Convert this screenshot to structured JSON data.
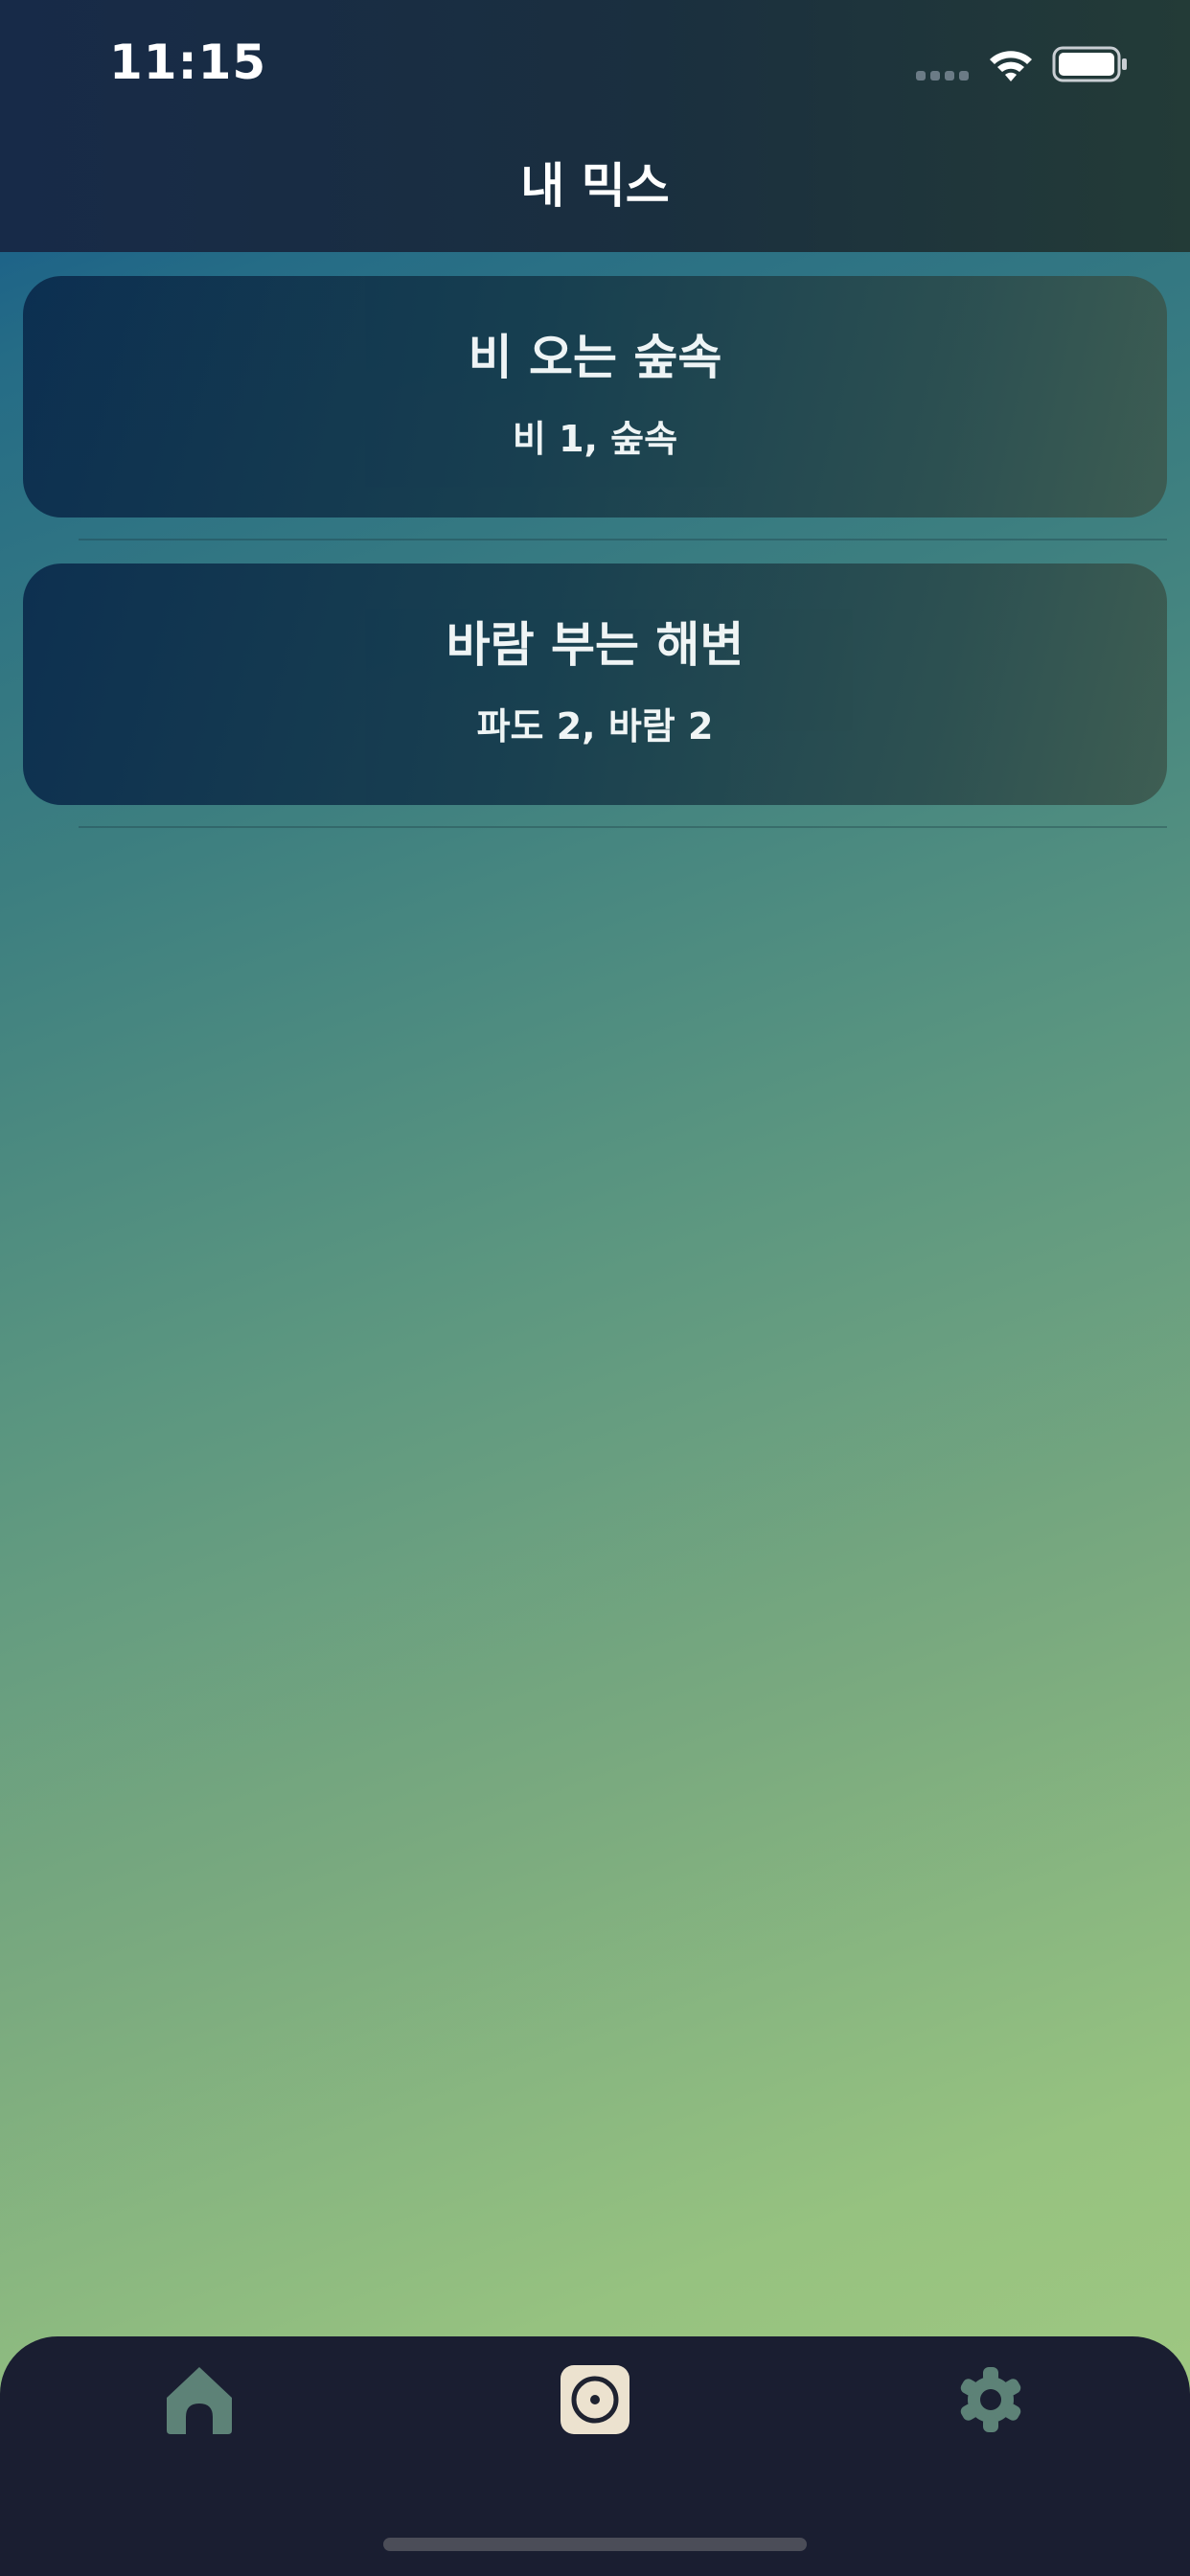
{
  "status_bar": {
    "time": "11:15"
  },
  "header": {
    "title": "내 믹스"
  },
  "mixes": [
    {
      "title": "비 오는 숲속",
      "subtitle": "비 1, 숲속"
    },
    {
      "title": "바람 부는 해변",
      "subtitle": "파도 2, 바람 2"
    }
  ],
  "tab_bar": {
    "tabs": [
      {
        "icon": "home-icon",
        "selected": false
      },
      {
        "icon": "disc-icon",
        "selected": true
      },
      {
        "icon": "gear-icon",
        "selected": false
      }
    ]
  },
  "colors": {
    "header_bg": "#1a2f3f",
    "tab_bar_bg": "#1a1e31",
    "selected_tab_bg": "#ece2cf",
    "inactive_icon": "#5d8277",
    "gradient_top": "#0d4f8c",
    "gradient_bottom": "#a3cb82"
  }
}
